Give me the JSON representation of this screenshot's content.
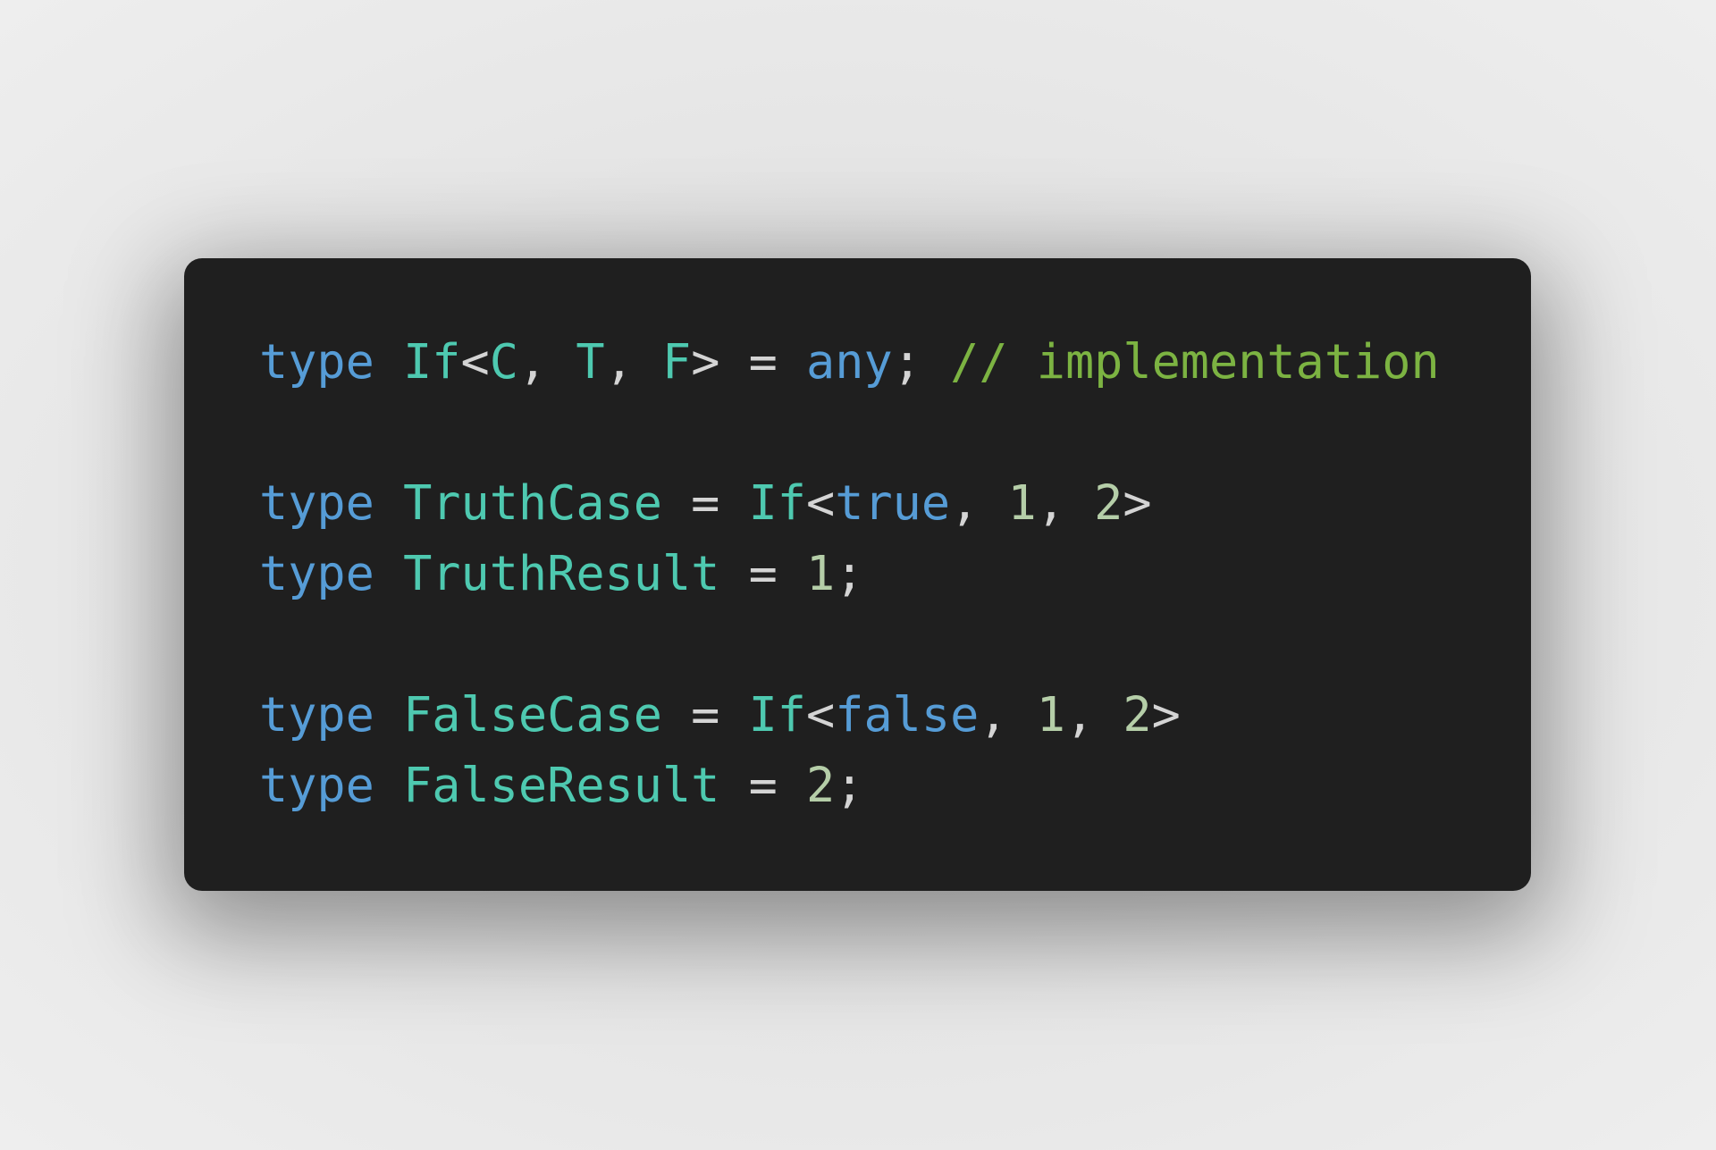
{
  "colors": {
    "background": "#e6e6e6",
    "card": "#1f1f1f",
    "keyword": "#569cd6",
    "type": "#4ec9b0",
    "number": "#b5cea8",
    "comment": "#7cb342",
    "punctuation": "#d4d4d4"
  },
  "code": {
    "language": "typescript",
    "lines": [
      {
        "tokens": [
          {
            "t": "kw",
            "v": "type"
          },
          {
            "t": "pn",
            "v": " "
          },
          {
            "t": "ty",
            "v": "If"
          },
          {
            "t": "pn",
            "v": "<"
          },
          {
            "t": "ty",
            "v": "C"
          },
          {
            "t": "pn",
            "v": ", "
          },
          {
            "t": "ty",
            "v": "T"
          },
          {
            "t": "pn",
            "v": ", "
          },
          {
            "t": "ty",
            "v": "F"
          },
          {
            "t": "pn",
            "v": "> = "
          },
          {
            "t": "kw",
            "v": "any"
          },
          {
            "t": "pn",
            "v": "; "
          },
          {
            "t": "cm",
            "v": "// implementation"
          }
        ]
      },
      {
        "tokens": []
      },
      {
        "tokens": [
          {
            "t": "kw",
            "v": "type"
          },
          {
            "t": "pn",
            "v": " "
          },
          {
            "t": "ty",
            "v": "TruthCase"
          },
          {
            "t": "pn",
            "v": " = "
          },
          {
            "t": "ty",
            "v": "If"
          },
          {
            "t": "pn",
            "v": "<"
          },
          {
            "t": "kw",
            "v": "true"
          },
          {
            "t": "pn",
            "v": ", "
          },
          {
            "t": "num",
            "v": "1"
          },
          {
            "t": "pn",
            "v": ", "
          },
          {
            "t": "num",
            "v": "2"
          },
          {
            "t": "pn",
            "v": ">"
          }
        ]
      },
      {
        "tokens": [
          {
            "t": "kw",
            "v": "type"
          },
          {
            "t": "pn",
            "v": " "
          },
          {
            "t": "ty",
            "v": "TruthResult"
          },
          {
            "t": "pn",
            "v": " = "
          },
          {
            "t": "num",
            "v": "1"
          },
          {
            "t": "pn",
            "v": ";"
          }
        ]
      },
      {
        "tokens": []
      },
      {
        "tokens": [
          {
            "t": "kw",
            "v": "type"
          },
          {
            "t": "pn",
            "v": " "
          },
          {
            "t": "ty",
            "v": "FalseCase"
          },
          {
            "t": "pn",
            "v": " = "
          },
          {
            "t": "ty",
            "v": "If"
          },
          {
            "t": "pn",
            "v": "<"
          },
          {
            "t": "kw",
            "v": "false"
          },
          {
            "t": "pn",
            "v": ", "
          },
          {
            "t": "num",
            "v": "1"
          },
          {
            "t": "pn",
            "v": ", "
          },
          {
            "t": "num",
            "v": "2"
          },
          {
            "t": "pn",
            "v": ">"
          }
        ]
      },
      {
        "tokens": [
          {
            "t": "kw",
            "v": "type"
          },
          {
            "t": "pn",
            "v": " "
          },
          {
            "t": "ty",
            "v": "FalseResult"
          },
          {
            "t": "pn",
            "v": " = "
          },
          {
            "t": "num",
            "v": "2"
          },
          {
            "t": "pn",
            "v": ";"
          }
        ]
      }
    ]
  }
}
